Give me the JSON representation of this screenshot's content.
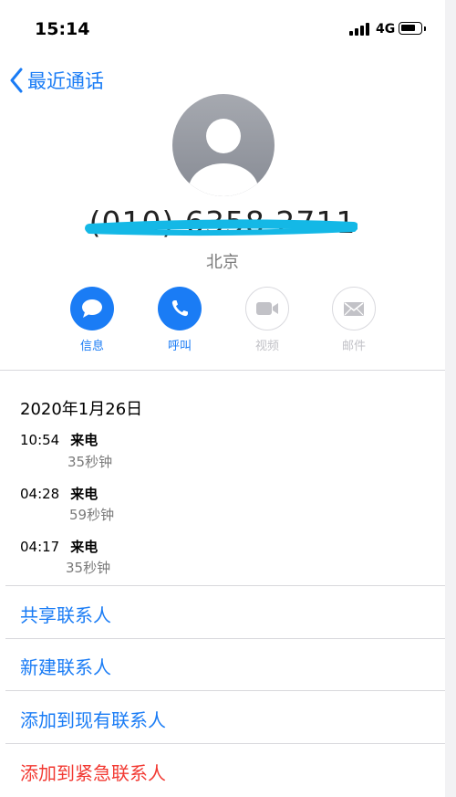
{
  "status_bar": {
    "time": "15:14",
    "network": "4G"
  },
  "nav": {
    "back_label": "最近通话"
  },
  "contact": {
    "number": "(010) 6358 2711",
    "location": "北京"
  },
  "actions": [
    {
      "label": "信息",
      "icon": "message-bubble-icon",
      "enabled": true
    },
    {
      "label": "呼叫",
      "icon": "phone-icon",
      "enabled": true
    },
    {
      "label": "视频",
      "icon": "video-camera-icon",
      "enabled": false
    },
    {
      "label": "邮件",
      "icon": "envelope-icon",
      "enabled": false
    }
  ],
  "history": {
    "date": "2020年1月26日",
    "calls": [
      {
        "time": "10:54",
        "type": "来电",
        "duration": "35秒钟"
      },
      {
        "time": "04:28",
        "type": "来电",
        "duration": "59秒钟"
      },
      {
        "time": "04:17",
        "type": "来电",
        "duration": "35秒钟"
      }
    ]
  },
  "menu": {
    "share": "共享联系人",
    "new_contact": "新建联系人",
    "add_existing": "添加到现有联系人",
    "add_emergency": "添加到紧急联系人"
  },
  "colors": {
    "accent": "#1a7cf5",
    "danger": "#f23a33",
    "scribble": "#14b8e6"
  }
}
